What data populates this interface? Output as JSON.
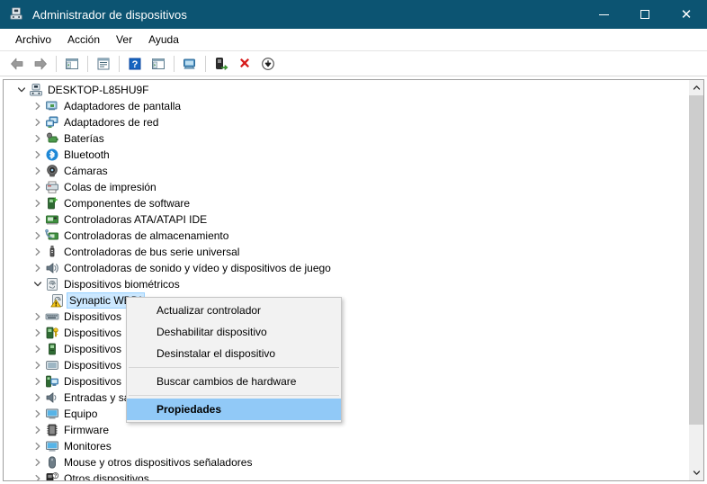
{
  "window": {
    "title": "Administrador de dispositivos",
    "icon": "device-manager-icon",
    "minimize_label": "Minimizar",
    "maximize_label": "Maximizar",
    "close_label": "Cerrar"
  },
  "menubar": {
    "items": [
      {
        "label": "Archivo",
        "name": "menu-archivo"
      },
      {
        "label": "Acción",
        "name": "menu-accion"
      },
      {
        "label": "Ver",
        "name": "menu-ver"
      },
      {
        "label": "Ayuda",
        "name": "menu-ayuda"
      }
    ]
  },
  "toolbar": {
    "buttons": [
      {
        "icon": "back-arrow-icon",
        "tooltip": "Atrás"
      },
      {
        "icon": "forward-arrow-icon",
        "tooltip": "Adelante"
      },
      {
        "icon": "show-hide-tree-icon",
        "tooltip": "Mostrar u ocultar árbol de consola"
      },
      {
        "icon": "properties-icon",
        "tooltip": "Propiedades"
      },
      {
        "icon": "help-icon",
        "tooltip": "Ayuda"
      },
      {
        "icon": "view-icon",
        "tooltip": "Ver"
      },
      {
        "icon": "scan-display-icon",
        "tooltip": "Mostrar dispositivos"
      },
      {
        "icon": "update-driver-icon",
        "tooltip": "Actualizar controlador"
      },
      {
        "icon": "uninstall-device-icon",
        "tooltip": "Desinstalar el dispositivo"
      },
      {
        "icon": "scan-hardware-changes-icon",
        "tooltip": "Buscar cambios de hardware"
      }
    ]
  },
  "tree": {
    "root": {
      "label": "DESKTOP-L85HU9F",
      "icon": "computer-icon",
      "expanded": true
    },
    "nodes": [
      {
        "label": "Adaptadores de pantalla",
        "icon": "display-adapter-icon",
        "expanded": false
      },
      {
        "label": "Adaptadores de red",
        "icon": "network-adapter-icon",
        "expanded": false
      },
      {
        "label": "Baterías",
        "icon": "battery-icon",
        "expanded": false
      },
      {
        "label": "Bluetooth",
        "icon": "bluetooth-icon",
        "expanded": false
      },
      {
        "label": "Cámaras",
        "icon": "camera-icon",
        "expanded": false
      },
      {
        "label": "Colas de impresión",
        "icon": "print-queue-icon",
        "expanded": false
      },
      {
        "label": "Componentes de software",
        "icon": "software-component-icon",
        "expanded": false
      },
      {
        "label": "Controladoras ATA/ATAPI IDE",
        "icon": "ata-controller-icon",
        "expanded": false
      },
      {
        "label": "Controladoras de almacenamiento",
        "icon": "storage-controller-icon",
        "expanded": false
      },
      {
        "label": "Controladoras de bus serie universal",
        "icon": "usb-controller-icon",
        "expanded": false
      },
      {
        "label": "Controladoras de sonido y vídeo y dispositivos de juego",
        "icon": "sound-controller-icon",
        "expanded": false
      },
      {
        "label": "Dispositivos biométricos",
        "icon": "biometric-icon",
        "expanded": true
      }
    ],
    "child_device": {
      "label": "Synaptic  WBDI",
      "icon": "biometric-warning-icon",
      "selected": true
    },
    "nodes_after": [
      {
        "label": "Dispositivos",
        "icon": "hid-device-icon",
        "expanded": false
      },
      {
        "label": "Dispositivos",
        "icon": "security-device-icon",
        "expanded": false
      },
      {
        "label": "Dispositivos",
        "icon": "system-device-icon",
        "expanded": false
      },
      {
        "label": "Dispositivos",
        "icon": "portable-device-icon",
        "expanded": false
      },
      {
        "label": "Dispositivos",
        "icon": "sw-device-icon",
        "expanded": false
      },
      {
        "label": "Entradas y sa",
        "icon": "audio-io-icon",
        "expanded": false
      },
      {
        "label": "Equipo",
        "icon": "computer-monitor-icon",
        "expanded": false
      },
      {
        "label": "Firmware",
        "icon": "firmware-icon",
        "expanded": false
      },
      {
        "label": "Monitores",
        "icon": "monitor-icon",
        "expanded": false
      },
      {
        "label": "Mouse y otros dispositivos señaladores",
        "icon": "mouse-icon",
        "expanded": false
      },
      {
        "label": "Otros dispositivos",
        "icon": "unknown-device-icon",
        "expanded": false
      }
    ]
  },
  "context_menu": {
    "items": [
      {
        "label": "Actualizar controlador",
        "name": "ctx-update-driver",
        "highlight": false
      },
      {
        "label": "Deshabilitar dispositivo",
        "name": "ctx-disable-device",
        "highlight": false
      },
      {
        "label": "Desinstalar el dispositivo",
        "name": "ctx-uninstall-device",
        "highlight": false
      },
      {
        "label": "Buscar cambios de hardware",
        "name": "ctx-scan-hardware",
        "highlight": false
      },
      {
        "label": "Propiedades",
        "name": "ctx-properties",
        "highlight": true
      }
    ]
  },
  "colors": {
    "titlebar": "#0c5472",
    "selection": "#cce8ff",
    "menu_highlight": "#91c9f7",
    "scrollbar_thumb": "#cdcdcd"
  }
}
